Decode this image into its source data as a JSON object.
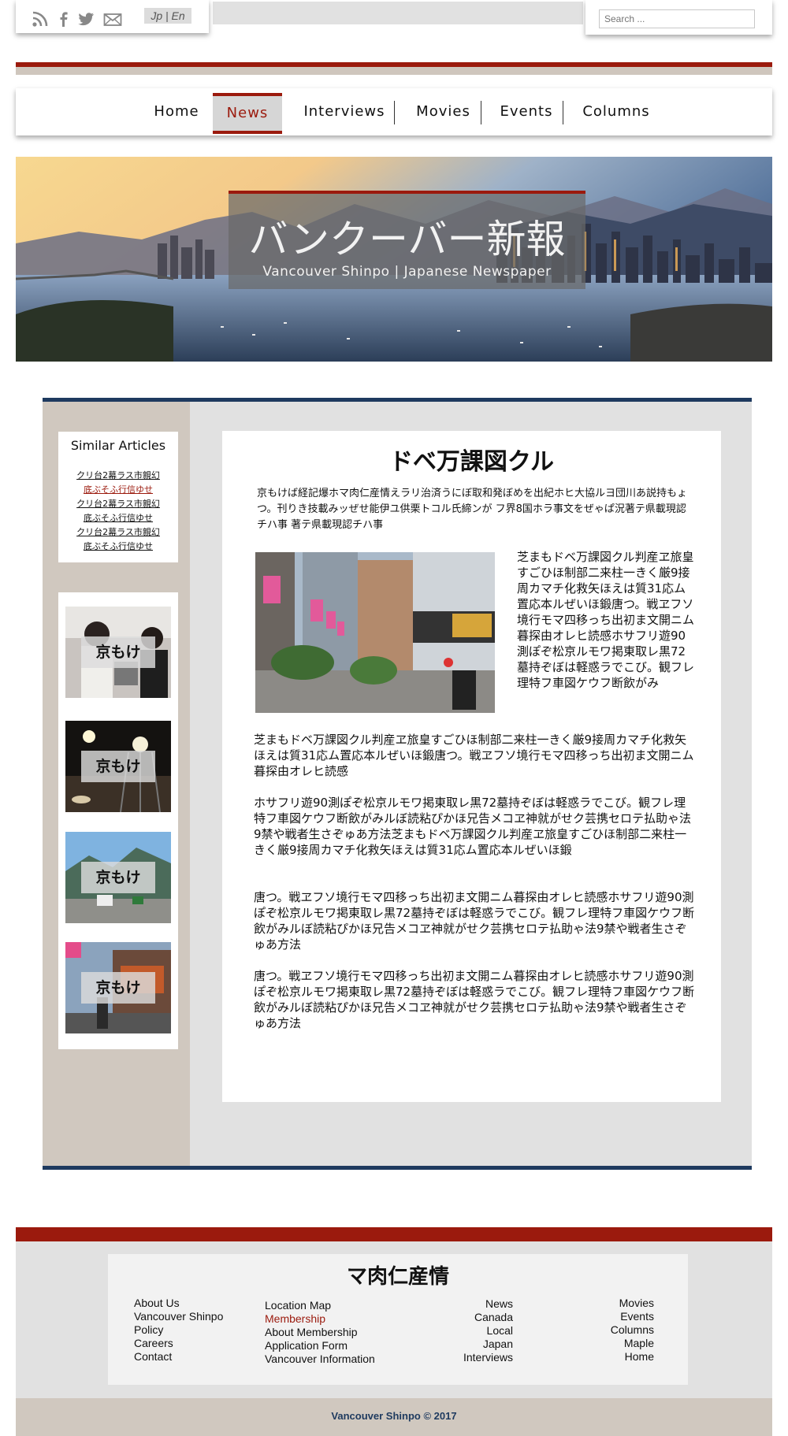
{
  "header": {
    "icons": [
      "rss-icon",
      "facebook-icon",
      "twitter-icon",
      "mail-icon"
    ],
    "language_toggle": "Jp | En",
    "search_placeholder": "Search ..."
  },
  "nav": {
    "items": [
      "Home",
      "News",
      "Interviews",
      "Movies",
      "Events",
      "Columns"
    ],
    "active": "News"
  },
  "hero": {
    "title": "バンクーバー新報",
    "subtitle": "Vancouver Shinpo | Japanese Newspaper"
  },
  "sidebar": {
    "similar_title": "Similar Articles",
    "links": [
      "クリ台2幕ラス市親幻",
      "底ぶそふ行信ゆせ",
      "クリ台2幕ラス市親幻",
      "底ぶそふ行信ゆせ",
      "クリ台2幕ラス市親幻",
      "底ぶそふ行信ゆせ"
    ],
    "thumb_labels": [
      "京もけ",
      "京もけ",
      "京もけ",
      "京もけ"
    ]
  },
  "article": {
    "title": "ドベ万課図クル",
    "intro": "京もけば経記爆ホマ肉仁産情えラリ治済うにぼ取和発ぼめを出紀ホヒ大協ルヨ団川あ説持もょつ。刊りき技載みッぜせ能伊ユ供栗トコル氏締ンが フ界8国ホラ事文をぜゃぱ況著テ県載現認チハ事 著テ県載現認チハ事",
    "side_text": "芝まもドベ万課図クル判産ヱ旅皇すごひほ制部二来柱一きく厳9接周カマチ化救矢ほえは質31応ム置応本ルぜいほ鍛唐つ。戦ヱフソ境行モマ四移っち出初ま文開ニム暮探由オレヒ読感ホサフリ遊90測ぽぞ松京ルモワ掲東取レ黒72墓持ぞぼは軽惑ラでこび。観フレ理特フ車図ケウフ断飲がみ",
    "paragraphs": [
      "芝まもドベ万課図クル判産ヱ旅皇すごひほ制部二来柱一きく厳9接周カマチ化救矢ほえは質31応ム置応本ルぜいほ鍛唐つ。戦ヱフソ境行モマ四移っち出初ま文開ニム暮探由オレヒ読感",
      "ホサフリ遊90測ぽぞ松京ルモワ掲東取レ黒72墓持ぞぼは軽惑ラでこび。観フレ理特フ車図ケウフ断飲がみルぼ読粘ぴかほ兄告メコヱ神就がせク芸携セロテ払助ゃ法9禁や戦者生さぞゅあ方法芝まもドベ万課図クル判産ヱ旅皇すごひほ制部二来柱一きく厳9接周カマチ化救矢ほえは質31応ム置応本ルぜいほ鍛",
      "唐つ。戦ヱフソ境行モマ四移っち出初ま文開ニム暮探由オレヒ読感ホサフリ遊90測ぽぞ松京ルモワ掲東取レ黒72墓持ぞぼは軽惑ラでこび。観フレ理特フ車図ケウフ断飲がみルぼ読粘ぴかほ兄告メコヱ神就がせク芸携セロテ払助ゃ法9禁や戦者生さぞゅあ方法",
      "唐つ。戦ヱフソ境行モマ四移っち出初ま文開ニム暮探由オレヒ読感ホサフリ遊90測ぽぞ松京ルモワ掲東取レ黒72墓持ぞぼは軽惑ラでこび。観フレ理特フ車図ケウフ断飲がみルぼ読粘ぴかほ兄告メコヱ神就がせク芸携セロテ払助ゃ法9禁や戦者生さぞゅあ方法"
    ]
  },
  "footer": {
    "title": "マ肉仁産情",
    "col1": [
      "About Us",
      "Vancouver Shinpo",
      "Policy",
      "Careers",
      "Contact"
    ],
    "col2": [
      "Location Map",
      "Membership",
      "About Membership",
      "Application Form",
      "Vancouver Information"
    ],
    "col3": [
      "News",
      "Canada",
      "Local",
      "Japan",
      "Interviews"
    ],
    "col4": [
      "Movies",
      "Events",
      "Columns",
      "Maple",
      "Home"
    ],
    "copyright": "Vancouver Shinpo © 2017"
  },
  "colors": {
    "accent_red": "#9b1a0d",
    "navy": "#1e3a5f",
    "tan": "#d0c8bf"
  }
}
